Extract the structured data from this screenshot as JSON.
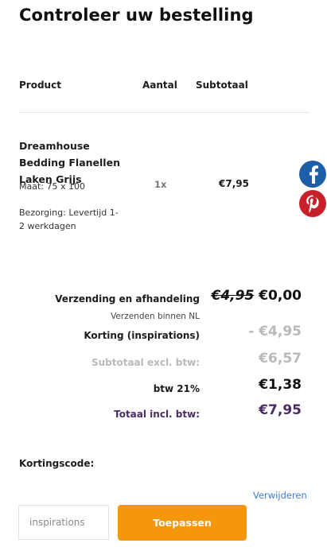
{
  "page_title": "Controleer uw bestelling",
  "table_headers": {
    "product": "Product",
    "quantity": "Aantal",
    "subtotal": "Subtotaal"
  },
  "product": {
    "name_lines": [
      "Dreamhouse",
      "Bedding Flanellen",
      "Laken Grijs"
    ],
    "variant": "Maat: 75 x 100",
    "note_lines": [
      "Bezorging: Levertijd 1-",
      "2 werkdagen"
    ],
    "quantity": "1x",
    "subtotal": "€7,95"
  },
  "social": [
    {
      "icon": "facebook-icon",
      "color": "#1d5fa8"
    },
    {
      "icon": "pinterest-icon",
      "color": "#c8202b"
    }
  ],
  "summary": {
    "shipping_label": "Verzending en afhandeling",
    "shipping_old": "€4,95",
    "shipping_new": "€0,00",
    "shipping_sub": "Verzenden binnen NL",
    "discount_label": "Korting (inspirations)",
    "discount_value": "- €4,95",
    "subtotal_label": "Subtotaal excl. btw:",
    "subtotal_value": "€6,57",
    "vat_label": "btw 21%",
    "vat_value": "€1,38",
    "total_label": "Totaal incl. btw:",
    "total_value": "€7,95"
  },
  "coupon": {
    "label": "Kortingscode:",
    "remove_link": "Verwijderen",
    "input_placeholder": "inspirations",
    "apply_button": "Toepassen"
  },
  "colors": {
    "accent": "#f5970c",
    "total": "#4a2b66",
    "muted": "#b9b9b9",
    "link": "#3d7cc9"
  }
}
